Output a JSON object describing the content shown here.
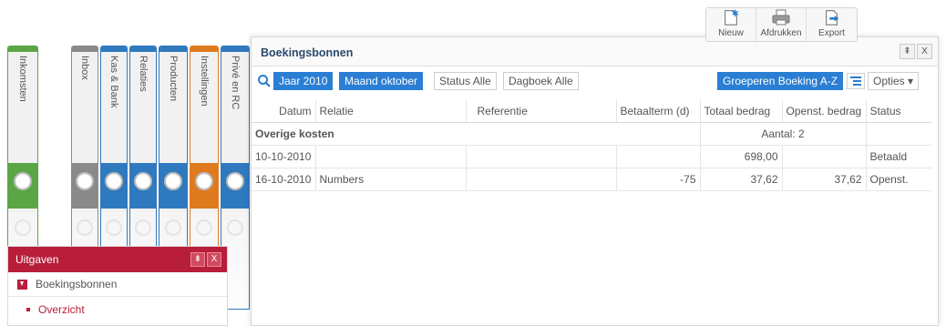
{
  "binders": [
    {
      "label": "Inkomsten",
      "color": "#5aa646"
    },
    {
      "label": "Inbox",
      "color": "#8a8a8a"
    },
    {
      "label": "Kas & Bank",
      "color": "#2f79bf"
    },
    {
      "label": "Relaties",
      "color": "#2f79bf"
    },
    {
      "label": "Producten",
      "color": "#2f79bf"
    },
    {
      "label": "Instellingen",
      "color": "#e07a1e"
    },
    {
      "label": "Privé en RC",
      "color": "#2f79bf"
    }
  ],
  "panel": {
    "title": "Boekingsbonnen",
    "toolbar": {
      "new_label": "Nieuw",
      "print_label": "Afdrukken",
      "export_label": "Export"
    },
    "pin_label": "⇞",
    "close_label": "X"
  },
  "filters": {
    "year": "Jaar 2010",
    "month": "Maand oktober",
    "status": "Status Alle",
    "journal": "Dagboek Alle",
    "group": "Groeperen Boeking A-Z",
    "options": "Opties ▾"
  },
  "table": {
    "headers": {
      "date": "Datum",
      "relation": "Relatie",
      "reference": "Referentie",
      "term": "Betaalterm (d)",
      "total": "Totaal bedrag",
      "open": "Openst. bedrag",
      "status": "Status"
    },
    "group": {
      "title": "Overige kosten",
      "count": "Aantal: 2"
    },
    "rows": [
      {
        "date": "10-10-2010",
        "relation": "",
        "reference": "",
        "term": "",
        "total": "698,00",
        "open": "",
        "status": "Betaald"
      },
      {
        "date": "16-10-2010",
        "relation": "Numbers",
        "reference": "",
        "term": "-75",
        "total": "37,62",
        "open": "37,62",
        "status": "Openst."
      }
    ]
  },
  "uitgaven": {
    "title": "Uitgaven",
    "pin_label": "⇟",
    "close_label": "X",
    "item": "Boekingsbonnen",
    "subitem": "Overzicht"
  },
  "colors": {
    "accent_blue": "#2a7ed3",
    "uitgaven_red": "#b81e3a"
  }
}
